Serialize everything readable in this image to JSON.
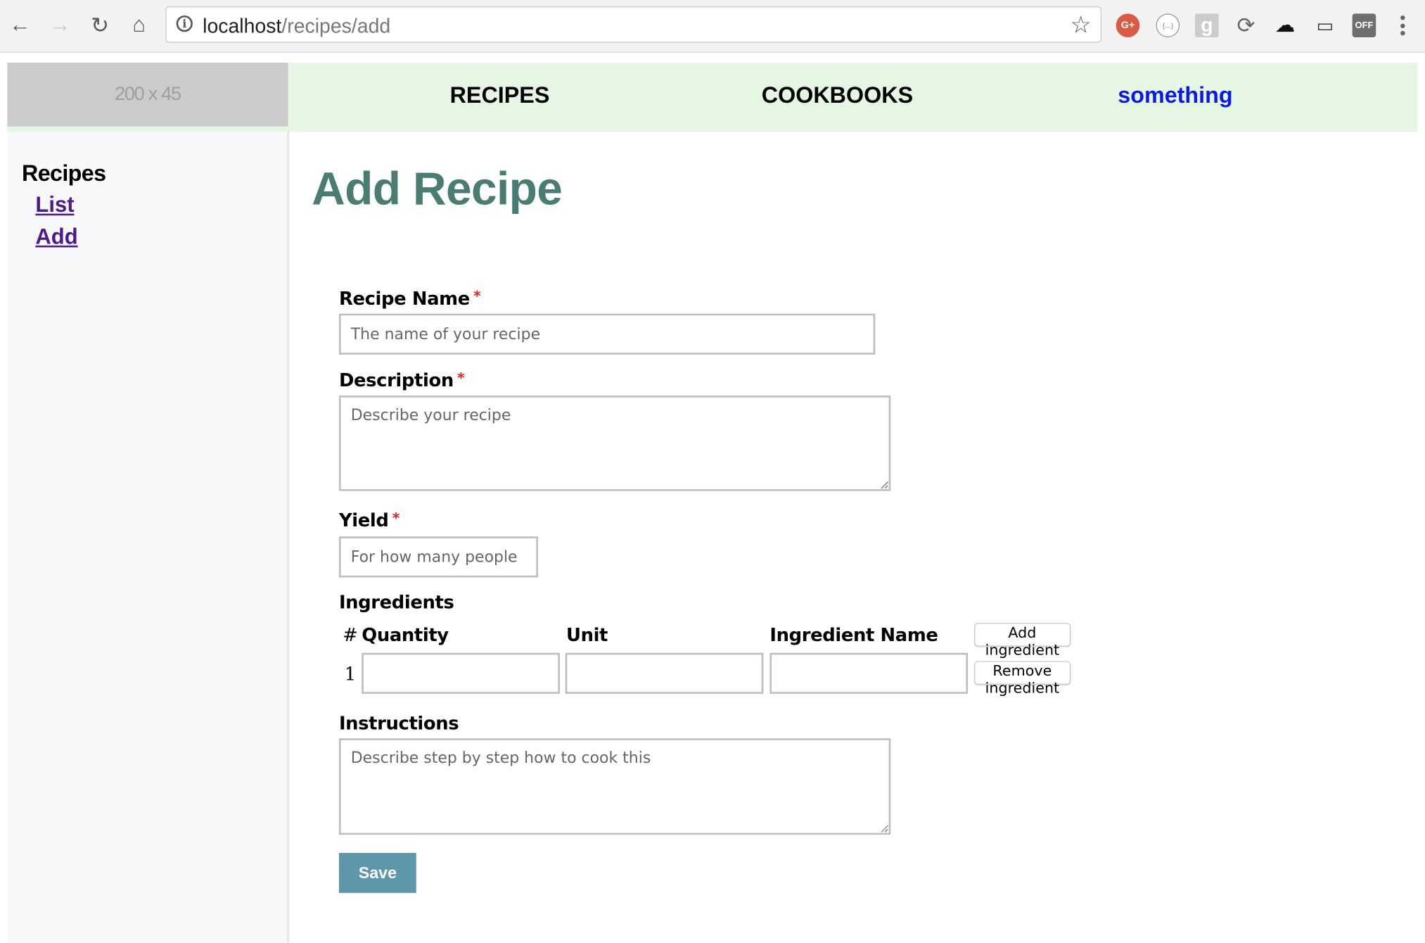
{
  "browser": {
    "url_host": "localhost",
    "url_path": "/recipes/add",
    "nav": {
      "back": "←",
      "forward": "→",
      "reload": "↻",
      "home": "⌂"
    },
    "bookmark_icon": "star-icon",
    "extensions": [
      {
        "name": "google-plus-icon",
        "glyph": "G+"
      },
      {
        "name": "json-viewer-icon",
        "glyph": "{...}"
      },
      {
        "name": "google-icon",
        "glyph": "g"
      },
      {
        "name": "sync-icon",
        "glyph": "⟳"
      },
      {
        "name": "add-account-icon",
        "glyph": "☁"
      },
      {
        "name": "cast-icon",
        "glyph": "▭"
      },
      {
        "name": "off-toggle-icon",
        "glyph": "OFF"
      }
    ]
  },
  "header": {
    "logo_placeholder": "200 x 45",
    "nav": [
      {
        "label": "RECIPES"
      },
      {
        "label": "COOKBOOKS"
      },
      {
        "label": "something"
      }
    ]
  },
  "sidebar": {
    "title": "Recipes",
    "links": [
      {
        "label": "List"
      },
      {
        "label": "Add"
      }
    ]
  },
  "main": {
    "title": "Add Recipe",
    "form": {
      "required_marker": "*",
      "recipe_name": {
        "label": "Recipe Name",
        "placeholder": "The name of your recipe",
        "value": ""
      },
      "description": {
        "label": "Description",
        "placeholder": "Describe your recipe",
        "value": ""
      },
      "yield": {
        "label": "Yield",
        "placeholder": "For how many people",
        "value": ""
      },
      "ingredients": {
        "label": "Ingredients",
        "columns": {
          "number": "#",
          "quantity": "Quantity",
          "unit": "Unit",
          "name": "Ingredient Name"
        },
        "add_label": "Add ingredient",
        "remove_label": "Remove ingredient",
        "rows": [
          {
            "number": "1",
            "quantity": "",
            "unit": "",
            "name": ""
          }
        ]
      },
      "instructions": {
        "label": "Instructions",
        "placeholder": "Describe step by step how to cook this",
        "value": ""
      },
      "save_label": "Save"
    }
  },
  "colors": {
    "nav_bg": "#e5f6e2",
    "title": "#4a7d72",
    "save_bg": "#5e97ac",
    "link_visited": "#4b1a8c",
    "nav_alt_link": "#0a18f0",
    "required": "#e0231d"
  }
}
